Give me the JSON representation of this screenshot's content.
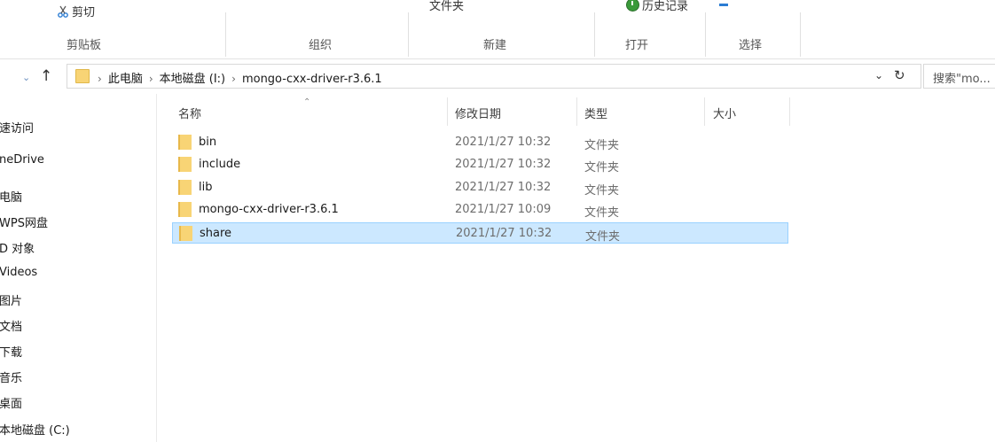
{
  "ribbon": {
    "cut_label": "剪切",
    "new_folder_partial": "文件夹",
    "history_partial": "历史记录",
    "groups": {
      "clipboard": "剪贴板",
      "organize": "组织",
      "new": "新建",
      "open": "打开",
      "select": "选择"
    }
  },
  "address": {
    "crumbs": [
      "此电脑",
      "本地磁盘 (I:)",
      "mongo-cxx-driver-r3.6.1"
    ],
    "search_placeholder": "搜索\"mo..."
  },
  "nav_pane": {
    "items": [
      "速访问",
      "neDrive",
      "电脑",
      "WPS网盘",
      "D 对象",
      "Videos",
      "图片",
      "文档",
      "下载",
      "音乐",
      "桌面",
      "本地磁盘 (C:)"
    ]
  },
  "columns": {
    "name": "名称",
    "modified": "修改日期",
    "type": "类型",
    "size": "大小"
  },
  "files": [
    {
      "name": "bin",
      "modified": "2021/1/27 10:32",
      "type": "文件夹"
    },
    {
      "name": "include",
      "modified": "2021/1/27 10:32",
      "type": "文件夹"
    },
    {
      "name": "lib",
      "modified": "2021/1/27 10:32",
      "type": "文件夹"
    },
    {
      "name": "mongo-cxx-driver-r3.6.1",
      "modified": "2021/1/27 10:09",
      "type": "文件夹"
    },
    {
      "name": "share",
      "modified": "2021/1/27 10:32",
      "type": "文件夹",
      "selected": true
    }
  ],
  "colors": {
    "selection_bg": "#cce8ff",
    "selection_border": "#99d1ff",
    "folder": "#f8d475"
  }
}
